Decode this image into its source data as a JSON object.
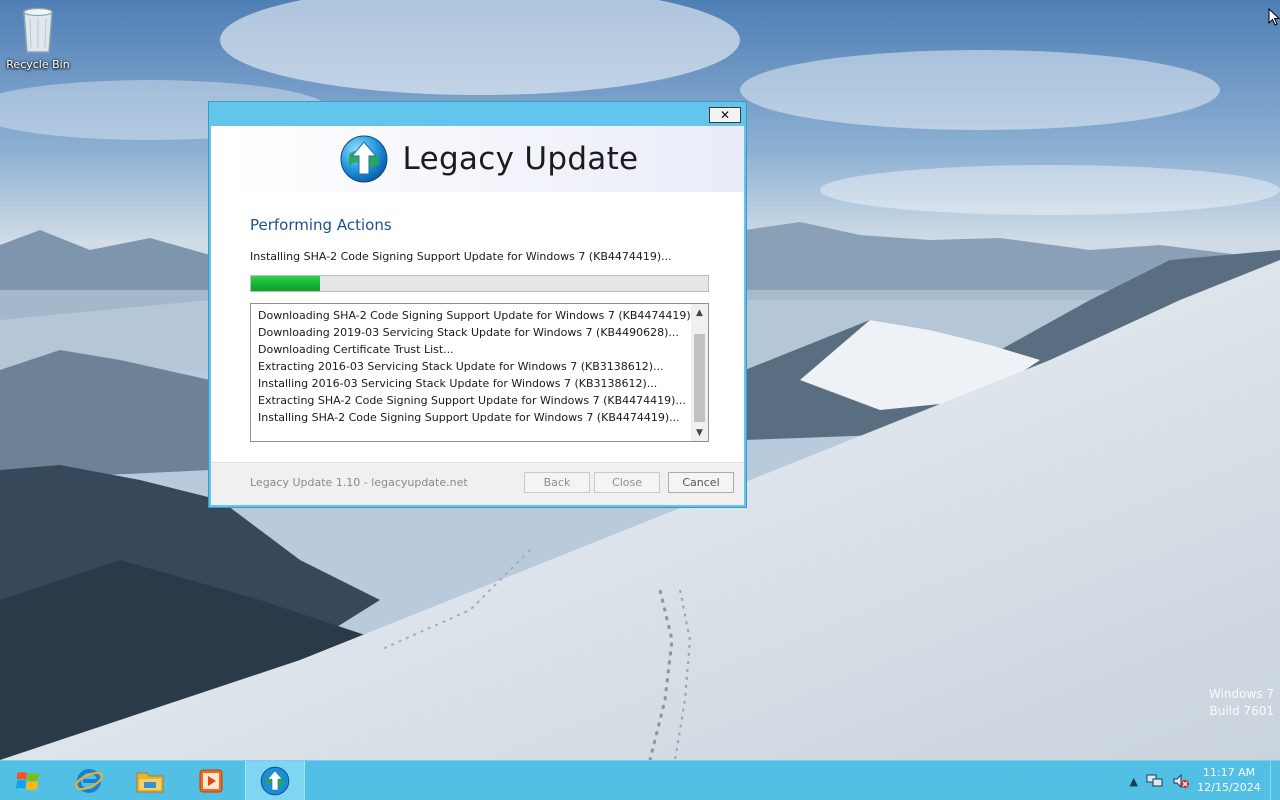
{
  "desktop": {
    "recycle_bin_label": "Recycle Bin",
    "watermark_line1": "Windows 7",
    "watermark_line2": "Build 7601"
  },
  "dialog": {
    "close_glyph": "✕",
    "product_name": "Legacy Update",
    "heading": "Performing Actions",
    "status_text": "Installing SHA-2 Code Signing Support Update for Windows 7 (KB4474419)...",
    "progress_fraction": 0.15,
    "log": [
      "Downloading SHA-2 Code Signing Support Update for Windows 7 (KB4474419)...",
      "Downloading 2019-03 Servicing Stack Update for Windows 7 (KB4490628)...",
      "Downloading Certificate Trust List...",
      "Extracting 2016-03 Servicing Stack Update for Windows 7 (KB3138612)...",
      "Installing 2016-03 Servicing Stack Update for Windows 7 (KB3138612)...",
      "Extracting SHA-2 Code Signing Support Update for Windows 7 (KB4474419)...",
      "Installing SHA-2 Code Signing Support Update for Windows 7 (KB4474419)..."
    ],
    "footer_version": "Legacy Update 1.10 - legacyupdate.net",
    "buttons": {
      "back": "Back",
      "close": "Close",
      "cancel": "Cancel"
    }
  },
  "taskbar": {
    "pinned": [
      "start-icon",
      "internet-explorer-icon",
      "file-explorer-icon",
      "media-player-icon",
      "legacy-update-icon"
    ],
    "tray_arrow": "▲",
    "clock_time": "11:17 AM",
    "clock_date": "12/15/2024"
  },
  "colors": {
    "taskbar": "#52bfe4",
    "dialog_frame": "#62c6ec",
    "heading": "#1f4f96",
    "progress": "#12b432"
  }
}
